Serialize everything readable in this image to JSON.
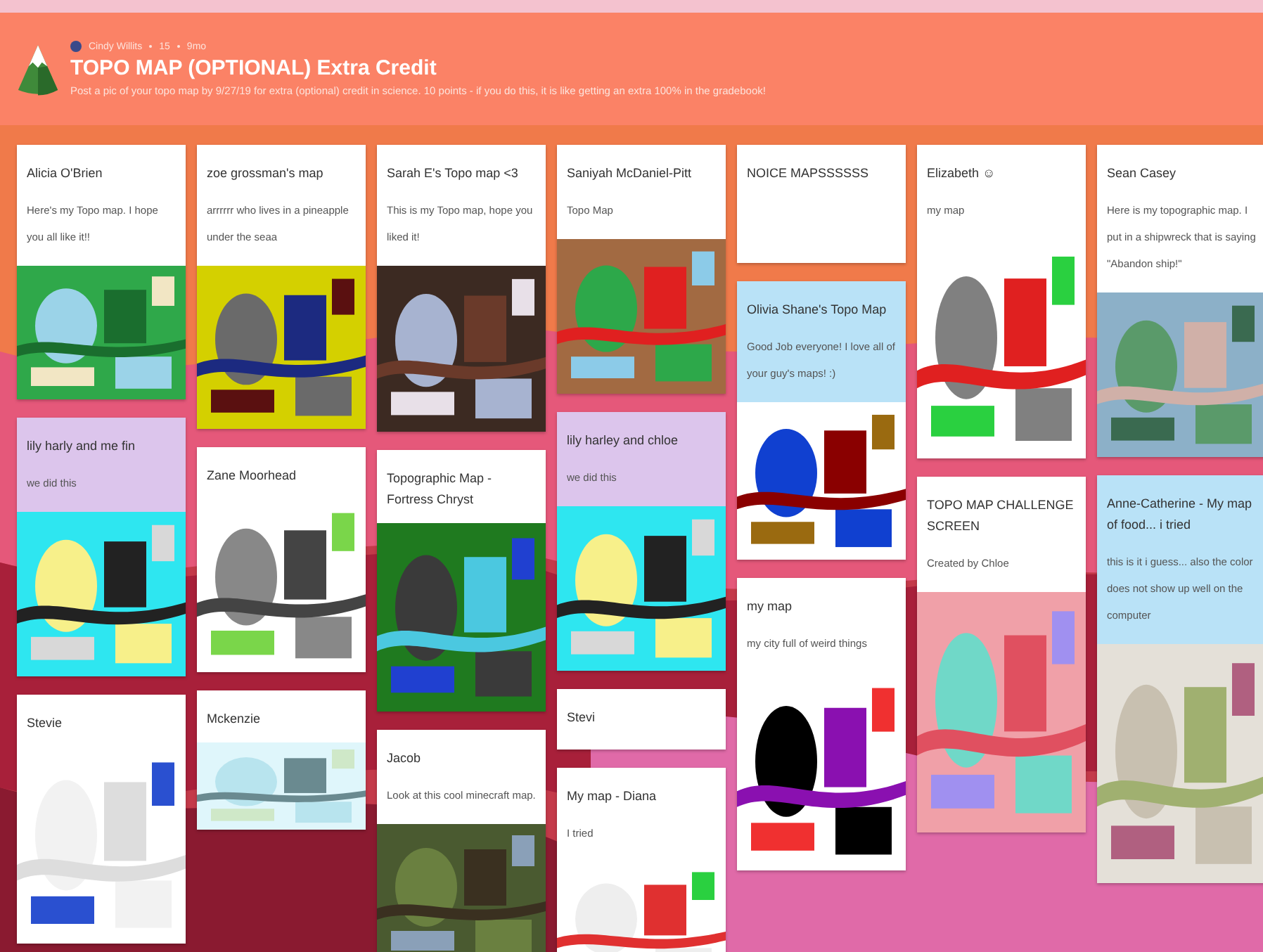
{
  "header": {
    "author": "Cindy Willits",
    "likes": "15",
    "time": "9mo",
    "title": "TOPO MAP (OPTIONAL) Extra Credit",
    "description": "Post a pic of your topo map by 9/27/19 for extra (optional) credit in science. 10 points - if you do this, it is like getting an extra 100% in the gradebook!"
  },
  "columns": [
    {
      "cards": [
        {
          "title": "Alicia O'Brien",
          "text": "Here's my Topo map. I hope you all like it!!",
          "color": "#ffffff"
        },
        {
          "title": "lily harly and me fin",
          "text": "we did this",
          "color": "#dcc5ec"
        },
        {
          "title": "Stevie",
          "color": "#ffffff"
        }
      ]
    },
    {
      "cards": [
        {
          "title": "zoe grossman's map",
          "text": "arrrrrr who lives in a pineapple under the seaa",
          "color": "#ffffff"
        },
        {
          "title": "Zane Moorhead",
          "color": "#ffffff"
        },
        {
          "title": "Mckenzie",
          "color": "#ffffff"
        }
      ]
    },
    {
      "cards": [
        {
          "title": "Sarah E's Topo map <3",
          "text": "This is my Topo map, hope you liked it!",
          "color": "#ffffff"
        },
        {
          "title": "Topographic Map - Fortress Chryst",
          "color": "#ffffff"
        },
        {
          "title": "Jacob",
          "text": "Look at this cool minecraft map.",
          "color": "#ffffff"
        }
      ]
    },
    {
      "cards": [
        {
          "title": "Saniyah McDaniel-Pitt",
          "text": "Topo Map",
          "color": "#ffffff"
        },
        {
          "title": "lily harley and chloe",
          "text": "we did this",
          "color": "#dcc5ec"
        },
        {
          "title": "Stevi",
          "color": "#ffffff"
        },
        {
          "title": "My map - Diana",
          "text": "I tried",
          "color": "#ffffff"
        }
      ]
    },
    {
      "cards": [
        {
          "title": "NOICE MAPSSSSSS",
          "color": "#ffffff"
        },
        {
          "title": "Olivia Shane's Topo Map",
          "text": "Good Job everyone! I love all of your guy's maps! :)",
          "color": "#b9e2f7"
        },
        {
          "title": "my map",
          "text": "my city full of weird things",
          "color": "#ffffff"
        }
      ]
    },
    {
      "cards": [
        {
          "title": "Elizabeth ☺",
          "text": "my map",
          "color": "#ffffff"
        },
        {
          "title": "TOPO MAP CHALLENGE SCREEN",
          "text": "Created by Chloe",
          "color": "#ffffff"
        }
      ]
    },
    {
      "cards": [
        {
          "title": "Sean Casey",
          "text": "Here is my topographic map.  I put in a shipwreck that is saying \"Abandon ship!\"",
          "color": "#ffffff"
        },
        {
          "title": "Anne-Catherine - My map of food... i tried",
          "text": "this is it i guess... also the color does not show up well on the computer",
          "color": "#b9e2f7"
        }
      ]
    }
  ]
}
